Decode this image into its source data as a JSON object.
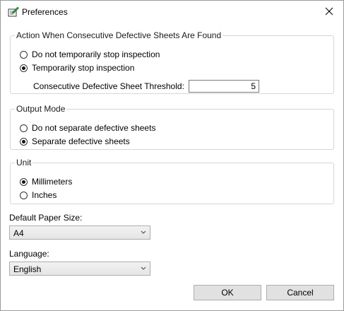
{
  "window": {
    "title": "Preferences"
  },
  "action_group": {
    "legend": "Action When Consecutive Defective Sheets Are Found",
    "options": [
      {
        "label": "Do not temporarily stop inspection",
        "checked": false
      },
      {
        "label": "Temporarily stop inspection",
        "checked": true
      }
    ],
    "threshold_label": "Consecutive Defective Sheet Threshold:",
    "threshold_value": "5"
  },
  "output_group": {
    "legend": "Output Mode",
    "options": [
      {
        "label": "Do not separate defective sheets",
        "checked": false
      },
      {
        "label": "Separate defective sheets",
        "checked": true
      }
    ]
  },
  "unit_group": {
    "legend": "Unit",
    "options": [
      {
        "label": "Millimeters",
        "checked": true
      },
      {
        "label": "Inches",
        "checked": false
      }
    ]
  },
  "paper_size": {
    "label": "Default Paper Size:",
    "value": "A4"
  },
  "language": {
    "label": "Language:",
    "value": "English"
  },
  "buttons": {
    "ok": "OK",
    "cancel": "Cancel"
  },
  "icons": {
    "app": "preferences-icon",
    "close": "close-icon",
    "dropdown": "chevron-down-icon"
  }
}
